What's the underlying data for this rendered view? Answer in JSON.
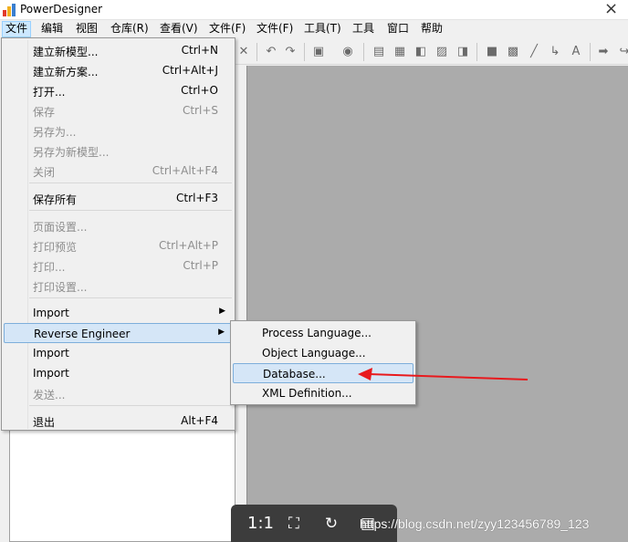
{
  "window": {
    "title": "PowerDesigner"
  },
  "menubar": {
    "items": [
      {
        "label": "文件"
      },
      {
        "label": "编辑"
      },
      {
        "label": "视图"
      },
      {
        "label": "仓库(R)"
      },
      {
        "label": "查看(V)"
      },
      {
        "label": "文件(F)"
      },
      {
        "label": "文件(F)"
      },
      {
        "label": "工具(T)"
      },
      {
        "label": "工具"
      },
      {
        "label": "窗口"
      },
      {
        "label": "帮助"
      }
    ]
  },
  "file_menu": {
    "items": [
      {
        "label": "建立新模型...",
        "shortcut": "Ctrl+N",
        "enabled": true
      },
      {
        "label": "建立新方案...",
        "shortcut": "Ctrl+Alt+J",
        "enabled": true
      },
      {
        "label": "打开...",
        "shortcut": "Ctrl+O",
        "enabled": true
      },
      {
        "label": "保存",
        "shortcut": "Ctrl+S",
        "enabled": false
      },
      {
        "label": "另存为...",
        "shortcut": "",
        "enabled": false
      },
      {
        "label": "另存为新模型...",
        "shortcut": "",
        "enabled": false
      },
      {
        "label": "关闭",
        "shortcut": "Ctrl+Alt+F4",
        "enabled": false
      },
      {
        "label": "保存所有",
        "shortcut": "Ctrl+F3",
        "enabled": true
      },
      {
        "label": "页面设置...",
        "shortcut": "",
        "enabled": false
      },
      {
        "label": "打印预览",
        "shortcut": "Ctrl+Alt+P",
        "enabled": false
      },
      {
        "label": "打印...",
        "shortcut": "Ctrl+P",
        "enabled": false
      },
      {
        "label": "打印设置...",
        "shortcut": "",
        "enabled": false
      },
      {
        "label": "Import",
        "shortcut": "",
        "enabled": true,
        "submenu": true
      },
      {
        "label": "Reverse Engineer",
        "shortcut": "",
        "enabled": true,
        "submenu": true,
        "highlighted": true
      },
      {
        "label": "Import",
        "shortcut": "",
        "enabled": true
      },
      {
        "label": "Import",
        "shortcut": "",
        "enabled": true
      },
      {
        "label": "发送...",
        "shortcut": "",
        "enabled": false
      },
      {
        "label": "退出",
        "shortcut": "Alt+F4",
        "enabled": true
      }
    ]
  },
  "reverse_engineer_submenu": {
    "items": [
      {
        "label": "Process Language..."
      },
      {
        "label": "Object Language..."
      },
      {
        "label": "Database...",
        "highlighted": true
      },
      {
        "label": "XML Definition..."
      }
    ]
  },
  "toolbar": {
    "icons": [
      "delete-icon",
      "undo-icon",
      "redo-icon",
      "properties-icon",
      "check-model-icon",
      "new-icon",
      "open-icon",
      "save-icon",
      "image-icon",
      "export-icon",
      "print-icon",
      "grid-icon",
      "line-icon",
      "link-icon",
      "text-icon",
      "forward-icon",
      "move-icon"
    ]
  },
  "viewer": {
    "ratio_label": "1:1",
    "watermark": "https://blog.csdn.net/zyy123456789_123"
  },
  "colors": {
    "workspace": "#ababab",
    "menu_highlight": "#d5e6f7",
    "arrow": "#e8191d"
  }
}
